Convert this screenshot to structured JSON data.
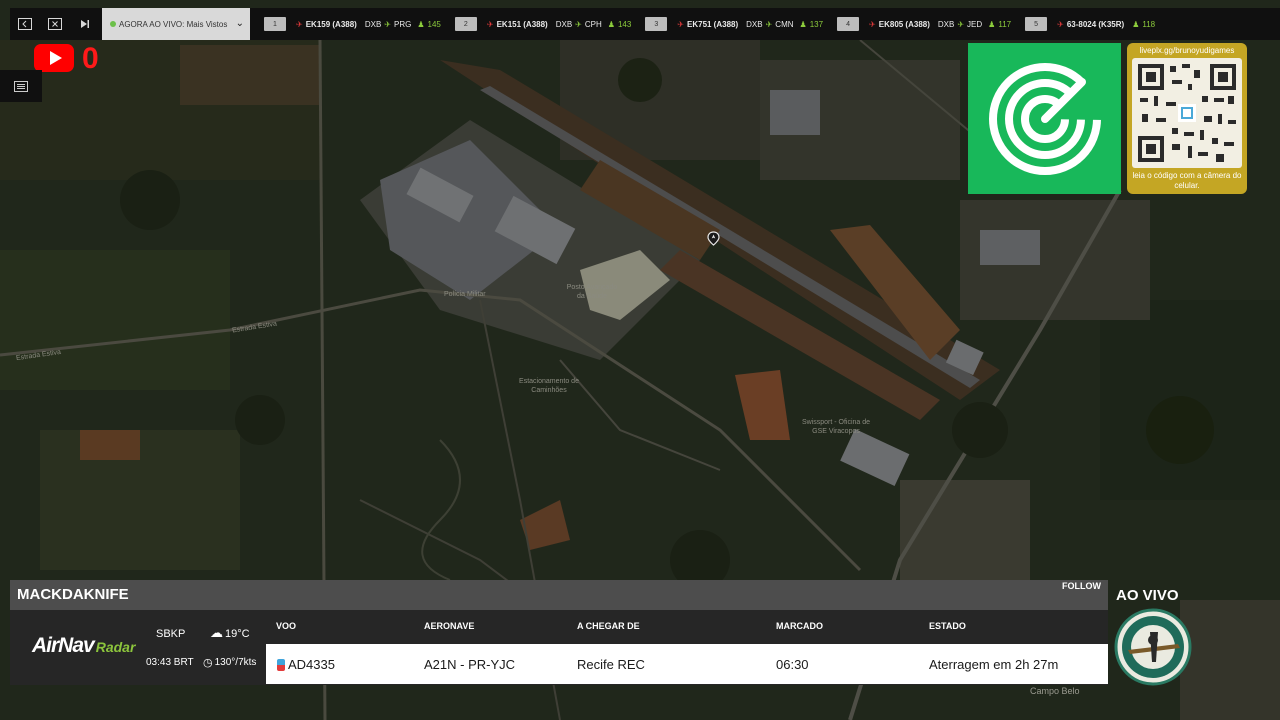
{
  "topbar": {
    "live_label": "AGORA AO VIVO: Mais Vistos",
    "flights": [
      {
        "num": "1",
        "callsign": "EK159 (A388)",
        "route": "DXB",
        "dest": "PRG",
        "count": "145"
      },
      {
        "num": "2",
        "callsign": "EK151 (A388)",
        "route": "DXB",
        "dest": "CPH",
        "count": "143"
      },
      {
        "num": "3",
        "callsign": "EK751 (A388)",
        "route": "DXB",
        "dest": "CMN",
        "count": "137"
      },
      {
        "num": "4",
        "callsign": "EK805 (A388)",
        "route": "DXB",
        "dest": "JED",
        "count": "117"
      },
      {
        "num": "5",
        "callsign": "63-8024 (K35R)",
        "route": "",
        "dest": "",
        "count": "118"
      }
    ]
  },
  "youtube": {
    "count": "0"
  },
  "qr": {
    "url": "liveplx.gg/brunoyudigames",
    "caption": "leia o código com a câmera do celular."
  },
  "map_labels": {
    "l1": "Estrada Estiva",
    "l2": "Estrada Estiva",
    "l3": "Estacionamento de Caminhões",
    "l4": "Swissport - Oficina de GSE Viracopos",
    "l5": "Campo Belo",
    "l6": "Polícia Militar",
    "l7": "Posto Avançado da Saúde"
  },
  "panel": {
    "title": "MACKDAKNIFE",
    "follow": "FOLLOW",
    "brand_main": "AirNav",
    "brand_sub": "Radar",
    "airport": "SBKP",
    "time": "03:43 BRT",
    "temp": "19°C",
    "wind": "130°/7kts",
    "headers": {
      "voo": "VOO",
      "aeronave": "AERONAVE",
      "chegar": "A CHEGAR DE",
      "marcado": "MARCADO",
      "estado": "ESTADO"
    },
    "row": {
      "voo": "AD4335",
      "aeronave": "A21N - PR-YJC",
      "chegar": "Recife REC",
      "marcado": "06:30",
      "estado": "Aterragem em 2h 27m"
    }
  },
  "live_badge": {
    "label": "AO VIVO"
  },
  "colors": {
    "accent_green": "#8dcc3c",
    "radar_green": "#18b85a",
    "qr_gold": "#c4a624",
    "youtube_red": "#ff0000"
  }
}
